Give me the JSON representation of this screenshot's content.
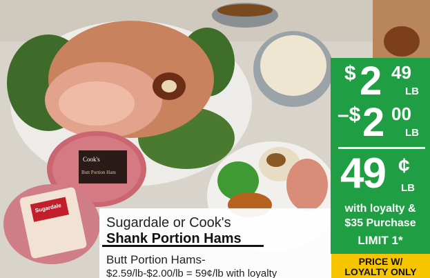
{
  "ad": {
    "brand_line": "Sugardale or Cook's",
    "product_title": "Shank Portion Hams",
    "sub_line1": "Butt Portion Hams-",
    "sub_line2": "$2.59/lb-$2.00/lb = 59¢/lb with loyalty"
  },
  "pricing": {
    "regular": {
      "dollar": "$",
      "whole": "2",
      "cents": "49",
      "unit": "LB"
    },
    "discount": {
      "sign": "–$",
      "whole": "2",
      "cents": "00",
      "unit": "LB"
    },
    "final": {
      "whole": "49",
      "cents_sign": "¢",
      "unit": "LB"
    },
    "loyalty_line1": "with loyalty &",
    "loyalty_line2": "$35 Purchase",
    "limit": "LIMIT 1*"
  },
  "badge": {
    "line1": "PRICE W/",
    "line2": "LOYALTY ONLY"
  },
  "package_labels": {
    "cooks_logo": "Cook's",
    "cooks_label": "Butt Portion Ham",
    "sugardale_label": "Sugardale"
  },
  "colors": {
    "panel_green": "#1f9e44",
    "badge_yellow": "#f6c500"
  }
}
